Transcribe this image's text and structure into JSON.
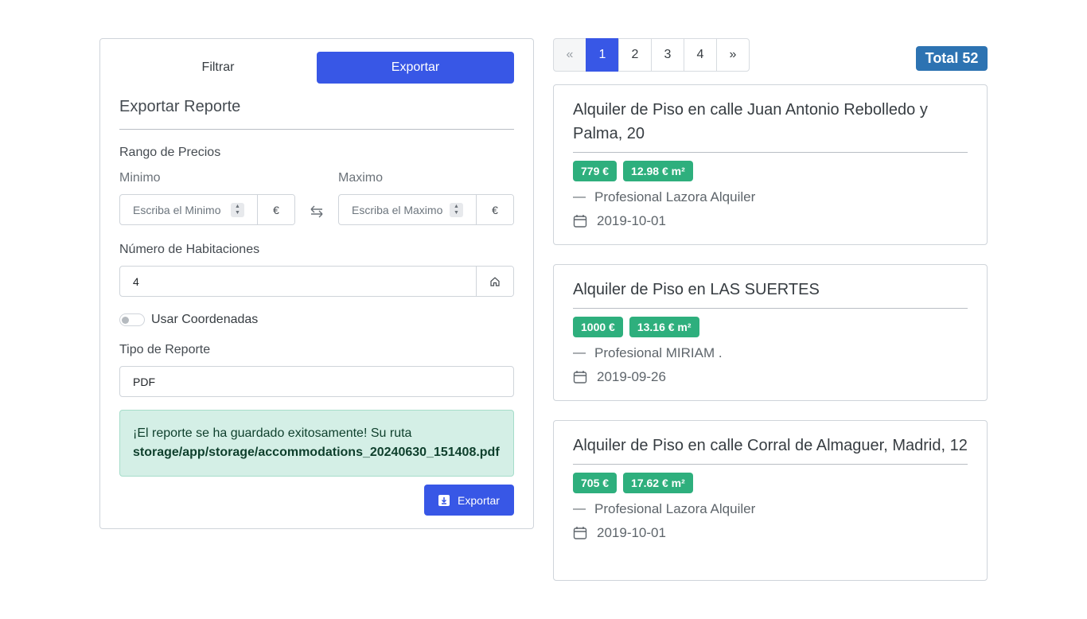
{
  "tabs": {
    "filter": "Filtrar",
    "export": "Exportar"
  },
  "form": {
    "title": "Exportar Reporte",
    "price_range_label": "Rango de Precios",
    "min_label": "Minimo",
    "min_placeholder": "Escriba el Minimo",
    "max_label": "Maximo",
    "max_placeholder": "Escriba el Maximo",
    "currency": "€",
    "rooms_label": "Número de Habitaciones",
    "rooms_value": "4",
    "coords_label": "Usar Coordenadas",
    "report_type_label": "Tipo de Reporte",
    "report_type_value": "PDF",
    "alert_text": "¡El reporte se ha guardado exitosamente! Su ruta ",
    "alert_path": "storage/app/storage/accommodations_20240630_151408.pdf",
    "export_button": "Exportar"
  },
  "pagination": {
    "prev": "«",
    "pages": [
      "1",
      "2",
      "3",
      "4"
    ],
    "next": "»",
    "active": "1"
  },
  "total": "Total 52",
  "listings": [
    {
      "title": "Alquiler de Piso en calle Juan Antonio Rebolledo y Palma, 20",
      "price": "779 €",
      "price_m2": "12.98 € m²",
      "agent": "Profesional Lazora Alquiler",
      "date": "2019-10-01"
    },
    {
      "title": "Alquiler de Piso en LAS SUERTES",
      "price": "1000 €",
      "price_m2": "13.16 € m²",
      "agent": "Profesional MIRIAM .",
      "date": "2019-09-26"
    },
    {
      "title": "Alquiler de Piso en calle Corral de Almaguer, Madrid, 12",
      "price": "705 €",
      "price_m2": "17.62 € m²",
      "agent": "Profesional Lazora Alquiler",
      "date": "2019-10-01"
    }
  ],
  "colors": {
    "primary": "#3857e6",
    "success": "#2eaf7d",
    "total_badge": "#2d73b2",
    "alert_bg": "#d4efe6"
  },
  "icons": {
    "swap": "swap-arrows-icon",
    "home": "home-icon",
    "calendar": "calendar-icon",
    "download": "download-icon"
  }
}
